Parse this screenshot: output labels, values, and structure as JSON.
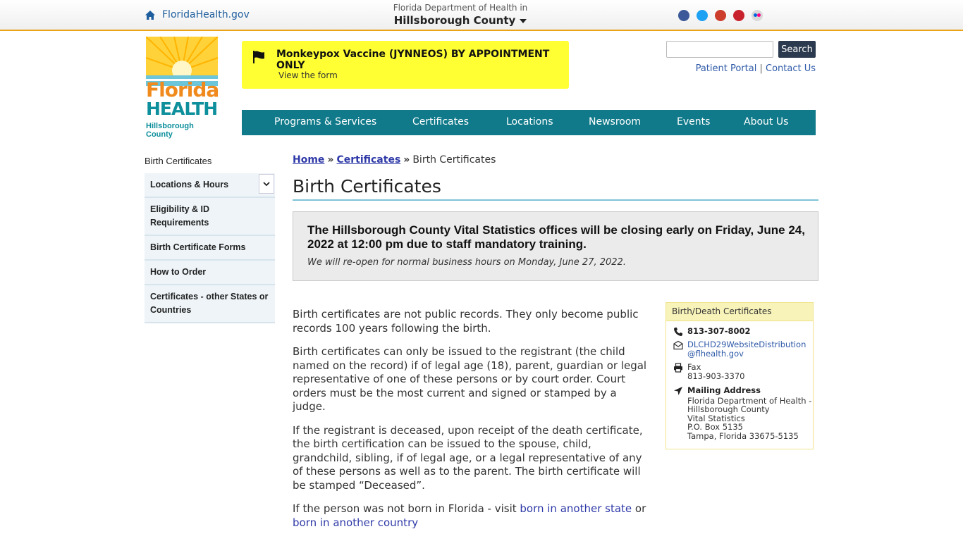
{
  "topbar": {
    "home_link": "FloridaHealth.gov",
    "county_sub": "Florida Department of Health in",
    "county_main": "Hillsborough County",
    "social_icons": [
      "facebook-icon",
      "twitter-icon",
      "youtube-icon",
      "pinterest-icon",
      "flickr-icon"
    ]
  },
  "logo": {
    "line1": "Florida",
    "line2": "HEALTH",
    "line3": "Hillsborough County"
  },
  "alert": {
    "title": "Monkeypox Vaccine (JYNNEOS) BY APPOINTMENT ONLY",
    "link": "View the form"
  },
  "search": {
    "placeholder": "",
    "button": "Search"
  },
  "util_links": {
    "patient_portal": "Patient Portal",
    "separator": "|",
    "contact_us": "Contact Us"
  },
  "nav": {
    "items": [
      "Programs & Services",
      "Certificates",
      "Locations",
      "Newsroom",
      "Events",
      "About Us"
    ]
  },
  "sidebar": {
    "title": "Birth Certificates",
    "items": [
      "Locations & Hours",
      "Eligibility & ID Requirements",
      "Birth Certificate Forms",
      "How to Order",
      "Certificates - other States or Countries"
    ]
  },
  "breadcrumb": {
    "home": "Home",
    "certificates": "Certificates",
    "current": "Birth Certificates",
    "sep": "»"
  },
  "page_title": "Birth Certificates",
  "notice": {
    "heading": "The Hillsborough County Vital Statistics offices will be closing early on Friday, June 24, 2022 at 12:00 pm due to staff mandatory training.",
    "sub": "We will re-open for normal business hours on Monday, June 27, 2022."
  },
  "body": {
    "p1": "Birth certificates are not public records. They only become public records 100 years following the birth.",
    "p2": "Birth certificates can only be issued to the registrant (the child named on the record) if of legal age (18), parent, guardian or legal representative of one of these persons or by court order. Court orders must be the most current and signed or stamped by a judge.",
    "p3": "If the registrant is deceased, upon receipt of the death certificate, the birth certification can be issued to the spouse, child, grandchild, sibling, if of legal age, or a legal representative of any of these persons as well as to the parent. The birth certificate will be stamped “Deceased”.",
    "p4_prefix": "If the person was not born in Florida - visit ",
    "p4_link1": "born in another state",
    "p4_mid": " or ",
    "p4_link2": "born in another country"
  },
  "contact": {
    "heading": "Birth/Death Certificates",
    "phone": "813-307-8002",
    "email_line1": "DLCHD29WebsiteDistribution",
    "email_line2": "@flhealth.gov",
    "fax_label": "Fax",
    "fax": "813-903-3370",
    "mail_label": "Mailing Address",
    "mail_lines": [
      "Florida Department of Health -",
      "Hillsborough County",
      "Vital Statistics",
      "P.O. Box 5135",
      "Tampa, Florida 33675-5135"
    ]
  },
  "colors": {
    "nav_teal": "#107a8a",
    "alert_yellow": "#ffff33",
    "accent_orange": "#e8a317",
    "link_blue": "#2f3aa8"
  }
}
